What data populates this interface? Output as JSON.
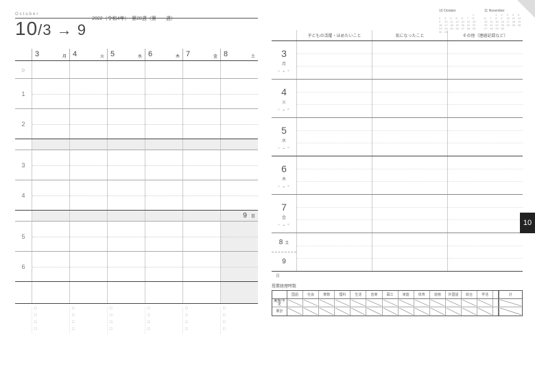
{
  "header": {
    "month_en": "October",
    "range": {
      "big": "10",
      "sep": "/",
      "start": "3",
      "arrow": " → ",
      "end": "9"
    },
    "meta": "2022（令和4年）　第28週〈第　　週〉"
  },
  "left": {
    "days": [
      {
        "num": "3",
        "yobi": "月"
      },
      {
        "num": "4",
        "yobi": "火"
      },
      {
        "num": "5",
        "yobi": "水"
      },
      {
        "num": "6",
        "yobi": "木"
      },
      {
        "num": "7",
        "yobi": "金"
      },
      {
        "num": "8",
        "yobi": "土"
      }
    ],
    "periods": [
      "○",
      "1",
      "2",
      "",
      "3",
      "4",
      "",
      "5",
      "6",
      ""
    ],
    "sunday": {
      "num": "9",
      "yobi": "日"
    },
    "checkbox": "□"
  },
  "right": {
    "columns": [
      "子どもの活躍・ほめたいこと",
      "気になったこと",
      "その他（連絡記録など）"
    ],
    "days": [
      {
        "num": "3",
        "yobi": "月"
      },
      {
        "num": "4",
        "yobi": "火"
      },
      {
        "num": "5",
        "yobi": "水"
      },
      {
        "num": "6",
        "yobi": "木"
      },
      {
        "num": "7",
        "yobi": "金"
      }
    ],
    "weekend": {
      "sat": "8",
      "sat_y": "土",
      "sun": "9",
      "sun_y": "日"
    },
    "weather": "☀ ☁ ☂",
    "subjects_title": "授業経理時数",
    "subjects": [
      "国語",
      "社会",
      "算数",
      "理科",
      "生活",
      "音楽",
      "図工",
      "家庭",
      "体育",
      "道徳",
      "外国語",
      "総合",
      "学活"
    ],
    "subj_total": "計",
    "subj_rows": [
      "実施/予定",
      "累計"
    ],
    "mini_cal_left": {
      "title": "10 October"
    },
    "mini_cal_right": {
      "title": "11 November"
    }
  },
  "tab": "10"
}
